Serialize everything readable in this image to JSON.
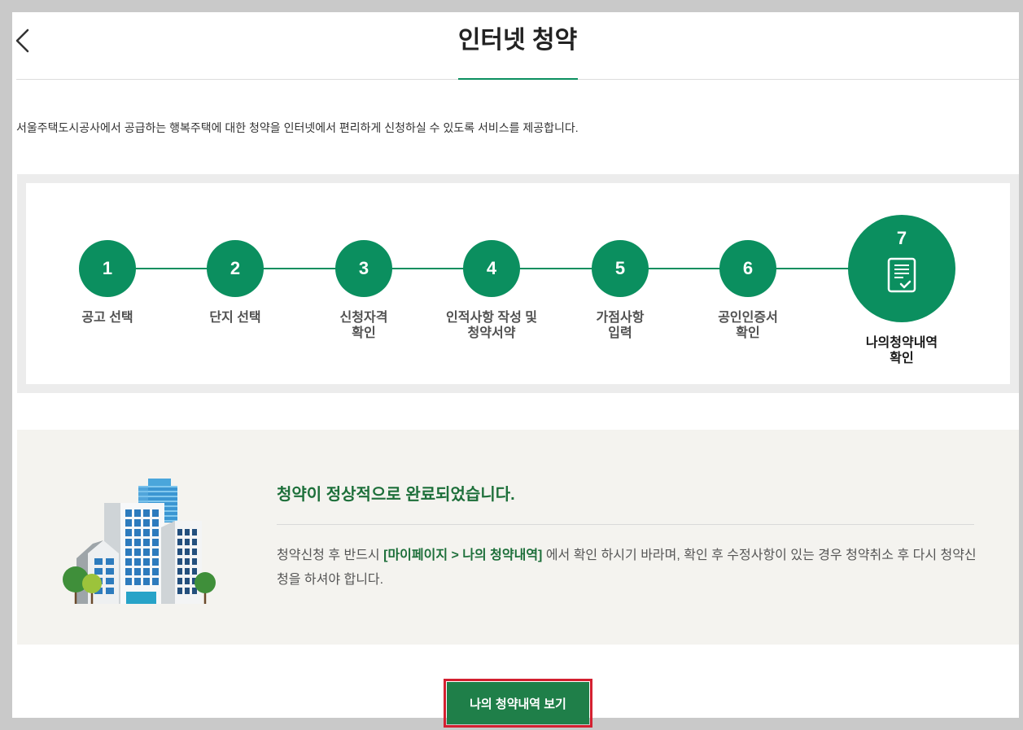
{
  "header": {
    "back_icon": "chevron-left-icon",
    "title": "인터넷 청약"
  },
  "intro": "서울주택도시공사에서 공급하는 행복주택에 대한 청약을 인터넷에서 편리하게 신청하실 수 있도록 서비스를 제공합니다.",
  "steps": {
    "current_step": 7,
    "items": [
      {
        "number": "1",
        "label": [
          "공고 선택"
        ]
      },
      {
        "number": "2",
        "label": [
          "단지 선택"
        ]
      },
      {
        "number": "3",
        "label": [
          "신청자격",
          "확인"
        ]
      },
      {
        "number": "4",
        "label": [
          "인적사항 작성 및",
          "청약서약"
        ]
      },
      {
        "number": "5",
        "label": [
          "가점사항",
          "입력"
        ]
      },
      {
        "number": "6",
        "label": [
          "공인인증서",
          "확인"
        ]
      },
      {
        "number": "7",
        "label": [
          "나의청약내역",
          "확인"
        ],
        "icon": "document-check-icon"
      }
    ]
  },
  "result": {
    "illustration": "buildings-illustration",
    "title": "청약이 정상적으로 완료되었습니다.",
    "message_start": "청약신청 후 반드시 ",
    "message_link": "[마이페이지 > 나의 청약내역]",
    "message_end": " 에서 확인 하시기 바라며, 확인 후 수정사항이 있는 경우 청약취소 후 다시 청약신청을 하셔야 합니다."
  },
  "button": {
    "label": "나의 청약내역 보기"
  },
  "colors": {
    "accent": "#0b8f5f",
    "heading_green": "#1d6f3a",
    "button_green": "#1f7f49",
    "highlight_red": "#d32030",
    "panel_bg": "#f4f3ef"
  }
}
